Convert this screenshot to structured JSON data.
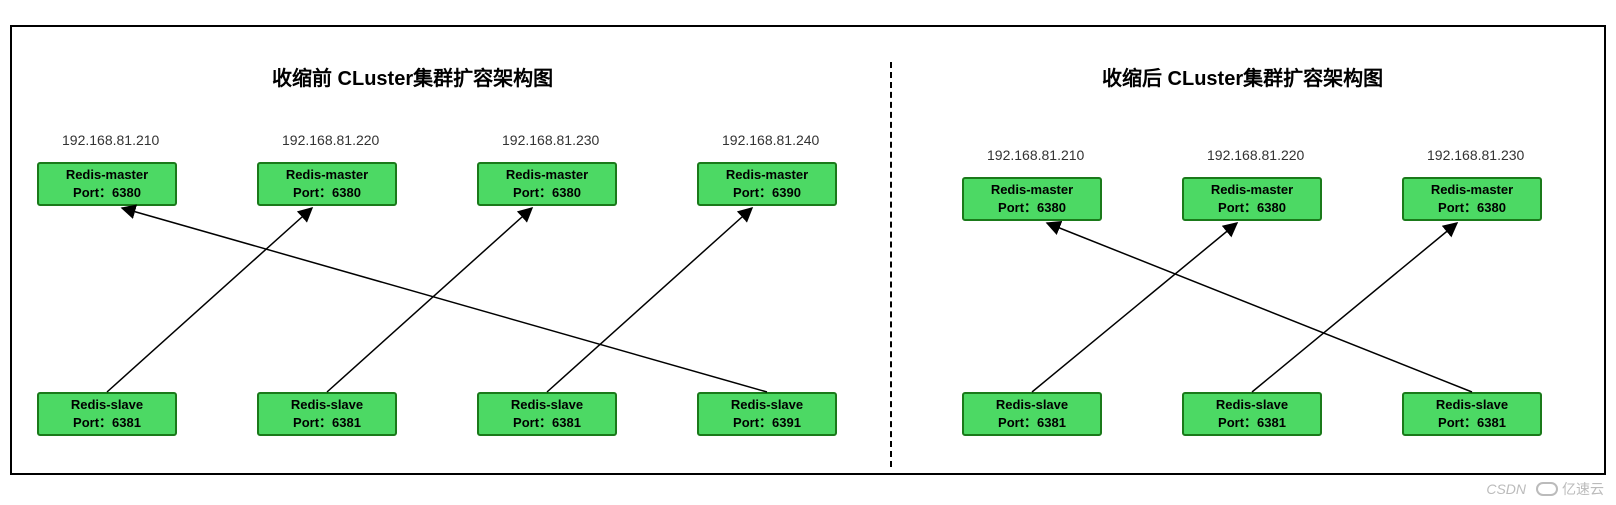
{
  "left_panel": {
    "title": "收缩前 CLuster集群扩容架构图",
    "columns": [
      {
        "ip": "192.168.81.210",
        "master_name": "Redis-master",
        "master_port": "Port：6380",
        "slave_name": "Redis-slave",
        "slave_port": "Port：6381"
      },
      {
        "ip": "192.168.81.220",
        "master_name": "Redis-master",
        "master_port": "Port：6380",
        "slave_name": "Redis-slave",
        "slave_port": "Port：6381"
      },
      {
        "ip": "192.168.81.230",
        "master_name": "Redis-master",
        "master_port": "Port：6380",
        "slave_name": "Redis-slave",
        "slave_port": "Port：6381"
      },
      {
        "ip": "192.168.81.240",
        "master_name": "Redis-master",
        "master_port": "Port：6390",
        "slave_name": "Redis-slave",
        "slave_port": "Port：6391"
      }
    ],
    "connections": [
      {
        "from_slave": 0,
        "to_master": 1
      },
      {
        "from_slave": 1,
        "to_master": 2
      },
      {
        "from_slave": 2,
        "to_master": 3
      },
      {
        "from_slave": 3,
        "to_master": 0
      }
    ]
  },
  "right_panel": {
    "title": "收缩后 CLuster集群扩容架构图",
    "columns": [
      {
        "ip": "192.168.81.210",
        "master_name": "Redis-master",
        "master_port": "Port：6380",
        "slave_name": "Redis-slave",
        "slave_port": "Port：6381"
      },
      {
        "ip": "192.168.81.220",
        "master_name": "Redis-master",
        "master_port": "Port：6380",
        "slave_name": "Redis-slave",
        "slave_port": "Port：6381"
      },
      {
        "ip": "192.168.81.230",
        "master_name": "Redis-master",
        "master_port": "Port：6380",
        "slave_name": "Redis-slave",
        "slave_port": "Port：6381"
      }
    ],
    "connections": [
      {
        "from_slave": 0,
        "to_master": 1
      },
      {
        "from_slave": 1,
        "to_master": 2
      },
      {
        "from_slave": 2,
        "to_master": 0
      }
    ]
  },
  "watermark": {
    "csdn": "CSDN",
    "yisu": "亿速云"
  }
}
